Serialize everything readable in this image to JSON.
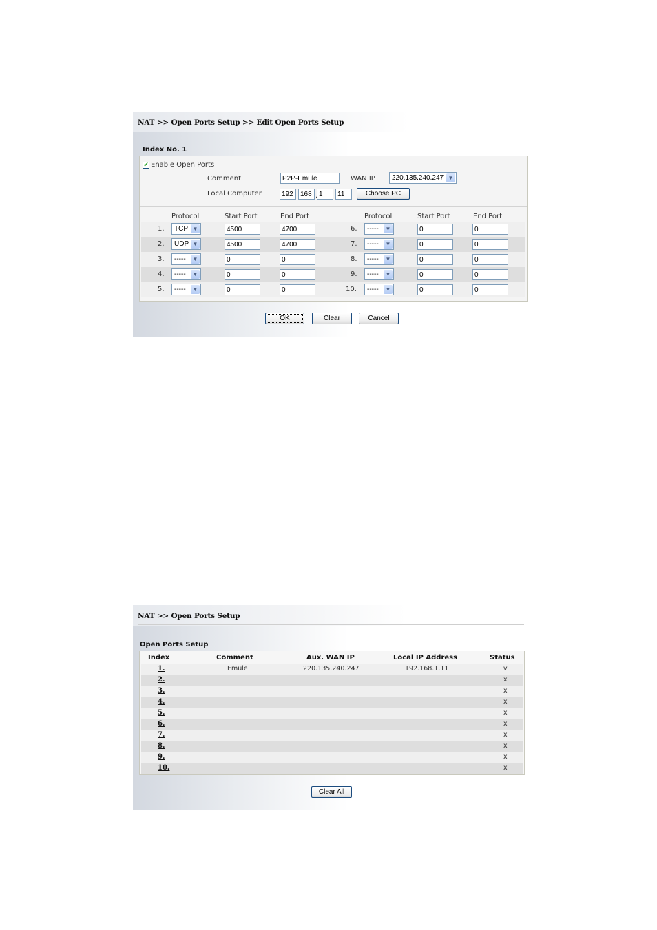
{
  "edit_page": {
    "breadcrumb": "NAT >> Open Ports Setup >> Edit Open Ports Setup",
    "index_title": "Index No. 1",
    "enable_label": "Enable Open Ports",
    "enable_checked": true,
    "comment_label": "Comment",
    "comment_value": "P2P-Emule",
    "wan_ip_label": "WAN IP",
    "wan_ip_value": "220.135.240.247",
    "local_computer_label": "Local Computer",
    "ip_octets": [
      "192",
      "168",
      "1",
      "11"
    ],
    "choose_pc_label": "Choose PC",
    "headers": {
      "protocol": "Protocol",
      "start_port": "Start Port",
      "end_port": "End Port"
    },
    "rows": [
      {
        "num": "1.",
        "protocol": "TCP",
        "start": "4500",
        "end": "4700"
      },
      {
        "num": "2.",
        "protocol": "UDP",
        "start": "4500",
        "end": "4700"
      },
      {
        "num": "3.",
        "protocol": "-----",
        "start": "0",
        "end": "0"
      },
      {
        "num": "4.",
        "protocol": "-----",
        "start": "0",
        "end": "0"
      },
      {
        "num": "5.",
        "protocol": "-----",
        "start": "0",
        "end": "0"
      },
      {
        "num": "6.",
        "protocol": "-----",
        "start": "0",
        "end": "0"
      },
      {
        "num": "7.",
        "protocol": "-----",
        "start": "0",
        "end": "0"
      },
      {
        "num": "8.",
        "protocol": "-----",
        "start": "0",
        "end": "0"
      },
      {
        "num": "9.",
        "protocol": "-----",
        "start": "0",
        "end": "0"
      },
      {
        "num": "10.",
        "protocol": "-----",
        "start": "0",
        "end": "0"
      }
    ],
    "buttons": {
      "ok": "OK",
      "clear": "Clear",
      "cancel": "Cancel"
    }
  },
  "list_page": {
    "breadcrumb": "NAT >> Open Ports Setup",
    "section_title": "Open Ports Setup",
    "columns": [
      "Index",
      "Comment",
      "Aux. WAN IP",
      "Local IP Address",
      "Status"
    ],
    "rows": [
      {
        "index": "1.",
        "comment": "Emule",
        "wan_ip": "220.135.240.247",
        "local_ip": "192.168.1.11",
        "status": "v"
      },
      {
        "index": "2.",
        "comment": "",
        "wan_ip": "",
        "local_ip": "",
        "status": "x"
      },
      {
        "index": "3.",
        "comment": "",
        "wan_ip": "",
        "local_ip": "",
        "status": "x"
      },
      {
        "index": "4.",
        "comment": "",
        "wan_ip": "",
        "local_ip": "",
        "status": "x"
      },
      {
        "index": "5.",
        "comment": "",
        "wan_ip": "",
        "local_ip": "",
        "status": "x"
      },
      {
        "index": "6.",
        "comment": "",
        "wan_ip": "",
        "local_ip": "",
        "status": "x"
      },
      {
        "index": "7.",
        "comment": "",
        "wan_ip": "",
        "local_ip": "",
        "status": "x"
      },
      {
        "index": "8.",
        "comment": "",
        "wan_ip": "",
        "local_ip": "",
        "status": "x"
      },
      {
        "index": "9.",
        "comment": "",
        "wan_ip": "",
        "local_ip": "",
        "status": "x"
      },
      {
        "index": "10.",
        "comment": "",
        "wan_ip": "",
        "local_ip": "",
        "status": "x"
      }
    ],
    "clear_all_label": "Clear All"
  },
  "icons": {
    "dropdown": "chevron-down-icon",
    "check": "checkmark-icon"
  }
}
